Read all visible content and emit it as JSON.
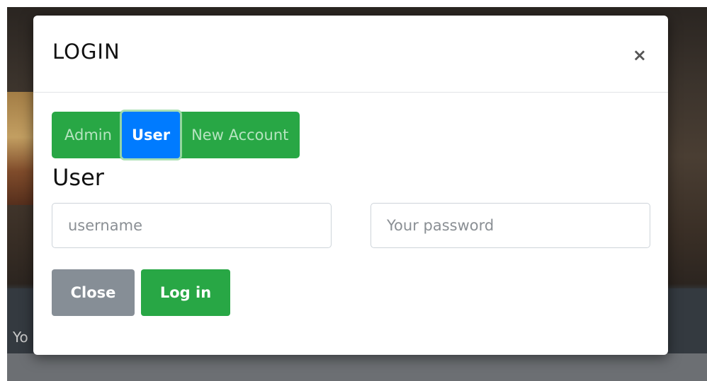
{
  "backdrop": {
    "footer_text": "Yo"
  },
  "modal": {
    "title": "LOGIN",
    "close_glyph": "×",
    "tabs": [
      {
        "label": "Admin",
        "active": false
      },
      {
        "label": "User",
        "active": true
      },
      {
        "label": "New Account",
        "active": false
      }
    ],
    "section_title": "User",
    "username": {
      "value": "",
      "placeholder": "username"
    },
    "password": {
      "value": "",
      "placeholder": "Your password"
    },
    "buttons": {
      "close_label": "Close",
      "login_label": "Log in"
    }
  },
  "colors": {
    "success": "#28a745",
    "primary": "#007bff",
    "secondary": "#868e96",
    "dark": "#343a40"
  }
}
